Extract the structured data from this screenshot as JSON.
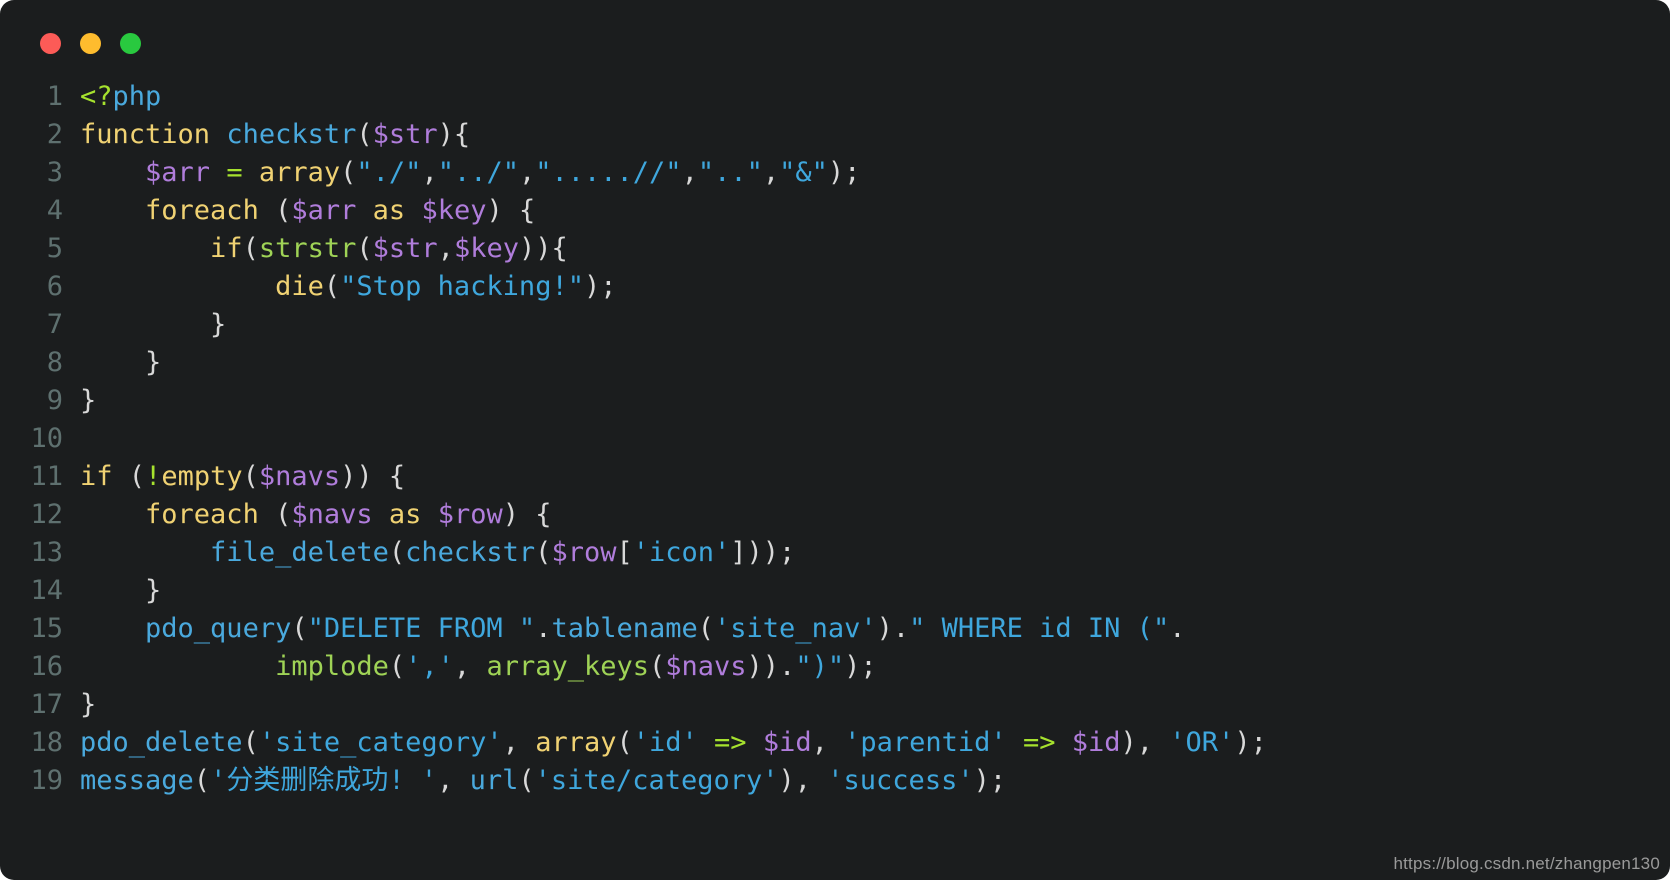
{
  "window": {
    "traffic_lights": [
      {
        "name": "close",
        "color": "#fc5b57"
      },
      {
        "name": "minimize",
        "color": "#febc2e"
      },
      {
        "name": "maximize",
        "color": "#29c93f"
      }
    ],
    "background": "#1b1d1e"
  },
  "editor": {
    "language": "php",
    "gutter_color": "#5e706f",
    "line_count": 19,
    "line_numbers": [
      "1",
      "2",
      "3",
      "4",
      "5",
      "6",
      "7",
      "8",
      "9",
      "10",
      "11",
      "12",
      "13",
      "14",
      "15",
      "16",
      "17",
      "18",
      "19"
    ],
    "lines": [
      {
        "n": "1",
        "text": "<?php"
      },
      {
        "n": "2",
        "text": "function checkstr($str){"
      },
      {
        "n": "3",
        "text": "    $arr = array(\"./\",\"../\",\".....//\",\"..\",\"&\");"
      },
      {
        "n": "4",
        "text": "    foreach ($arr as $key) {"
      },
      {
        "n": "5",
        "text": "        if(strstr($str,$key)){"
      },
      {
        "n": "6",
        "text": "            die(\"Stop hacking!\");"
      },
      {
        "n": "7",
        "text": "        }"
      },
      {
        "n": "8",
        "text": "    }"
      },
      {
        "n": "9",
        "text": "}"
      },
      {
        "n": "10",
        "text": ""
      },
      {
        "n": "11",
        "text": "if (!empty($navs)) {"
      },
      {
        "n": "12",
        "text": "    foreach ($navs as $row) {"
      },
      {
        "n": "13",
        "text": "        file_delete(checkstr($row['icon']));"
      },
      {
        "n": "14",
        "text": "    }"
      },
      {
        "n": "15",
        "text": "    pdo_query(\"DELETE FROM \".tablename('site_nav').\" WHERE id IN (\"."
      },
      {
        "n": "16",
        "text": "            implode(',', array_keys($navs)).\")\");"
      },
      {
        "n": "17",
        "text": "}"
      },
      {
        "n": "18",
        "text": "pdo_delete('site_category', array('id' => $id, 'parentid' => $id), 'OR');"
      },
      {
        "n": "19",
        "text": "message('分类删除成功! ', url('site/category'), 'success');"
      }
    ],
    "tokens": [
      [
        {
          "c": "tag",
          "t": "<?"
        },
        {
          "c": "fn",
          "t": "php"
        }
      ],
      [
        {
          "c": "kw",
          "t": "function"
        },
        {
          "c": "plain",
          "t": " "
        },
        {
          "c": "fn",
          "t": "checkstr"
        },
        {
          "c": "punct",
          "t": "("
        },
        {
          "c": "var",
          "t": "$str"
        },
        {
          "c": "punct",
          "t": "){"
        }
      ],
      [
        {
          "c": "plain",
          "t": "    "
        },
        {
          "c": "var",
          "t": "$arr"
        },
        {
          "c": "plain",
          "t": " "
        },
        {
          "c": "op",
          "t": "="
        },
        {
          "c": "plain",
          "t": " "
        },
        {
          "c": "kw",
          "t": "array"
        },
        {
          "c": "punct",
          "t": "("
        },
        {
          "c": "str",
          "t": "\"./\""
        },
        {
          "c": "punct",
          "t": ","
        },
        {
          "c": "str",
          "t": "\"../\""
        },
        {
          "c": "punct",
          "t": ","
        },
        {
          "c": "str",
          "t": "\".....//\""
        },
        {
          "c": "punct",
          "t": ","
        },
        {
          "c": "str",
          "t": "\"..\""
        },
        {
          "c": "punct",
          "t": ","
        },
        {
          "c": "str",
          "t": "\"&\""
        },
        {
          "c": "punct",
          "t": ");"
        }
      ],
      [
        {
          "c": "plain",
          "t": "    "
        },
        {
          "c": "kw",
          "t": "foreach"
        },
        {
          "c": "plain",
          "t": " "
        },
        {
          "c": "punct",
          "t": "("
        },
        {
          "c": "var",
          "t": "$arr"
        },
        {
          "c": "plain",
          "t": " "
        },
        {
          "c": "kw",
          "t": "as"
        },
        {
          "c": "plain",
          "t": " "
        },
        {
          "c": "var",
          "t": "$key"
        },
        {
          "c": "punct",
          "t": ") {"
        }
      ],
      [
        {
          "c": "plain",
          "t": "        "
        },
        {
          "c": "kw",
          "t": "if"
        },
        {
          "c": "punct",
          "t": "("
        },
        {
          "c": "builtin",
          "t": "strstr"
        },
        {
          "c": "punct",
          "t": "("
        },
        {
          "c": "var",
          "t": "$str"
        },
        {
          "c": "punct",
          "t": ","
        },
        {
          "c": "var",
          "t": "$key"
        },
        {
          "c": "punct",
          "t": ")){"
        }
      ],
      [
        {
          "c": "plain",
          "t": "            "
        },
        {
          "c": "kw",
          "t": "die"
        },
        {
          "c": "punct",
          "t": "("
        },
        {
          "c": "str",
          "t": "\"Stop hacking!\""
        },
        {
          "c": "punct",
          "t": ");"
        }
      ],
      [
        {
          "c": "plain",
          "t": "        "
        },
        {
          "c": "punct",
          "t": "}"
        }
      ],
      [
        {
          "c": "plain",
          "t": "    "
        },
        {
          "c": "punct",
          "t": "}"
        }
      ],
      [
        {
          "c": "punct",
          "t": "}"
        }
      ],
      [],
      [
        {
          "c": "kw",
          "t": "if"
        },
        {
          "c": "plain",
          "t": " "
        },
        {
          "c": "punct",
          "t": "("
        },
        {
          "c": "op",
          "t": "!"
        },
        {
          "c": "kw",
          "t": "empty"
        },
        {
          "c": "punct",
          "t": "("
        },
        {
          "c": "var",
          "t": "$navs"
        },
        {
          "c": "punct",
          "t": ")) {"
        }
      ],
      [
        {
          "c": "plain",
          "t": "    "
        },
        {
          "c": "kw",
          "t": "foreach"
        },
        {
          "c": "plain",
          "t": " "
        },
        {
          "c": "punct",
          "t": "("
        },
        {
          "c": "var",
          "t": "$navs"
        },
        {
          "c": "plain",
          "t": " "
        },
        {
          "c": "kw",
          "t": "as"
        },
        {
          "c": "plain",
          "t": " "
        },
        {
          "c": "var",
          "t": "$row"
        },
        {
          "c": "punct",
          "t": ") {"
        }
      ],
      [
        {
          "c": "plain",
          "t": "        "
        },
        {
          "c": "fn",
          "t": "file_delete"
        },
        {
          "c": "punct",
          "t": "("
        },
        {
          "c": "fn",
          "t": "checkstr"
        },
        {
          "c": "punct",
          "t": "("
        },
        {
          "c": "var",
          "t": "$row"
        },
        {
          "c": "punct",
          "t": "["
        },
        {
          "c": "str",
          "t": "'icon'"
        },
        {
          "c": "punct",
          "t": "]));"
        }
      ],
      [
        {
          "c": "plain",
          "t": "    "
        },
        {
          "c": "punct",
          "t": "}"
        }
      ],
      [
        {
          "c": "plain",
          "t": "    "
        },
        {
          "c": "fn",
          "t": "pdo_query"
        },
        {
          "c": "punct",
          "t": "("
        },
        {
          "c": "str",
          "t": "\"DELETE FROM \""
        },
        {
          "c": "punct",
          "t": "."
        },
        {
          "c": "fn",
          "t": "tablename"
        },
        {
          "c": "punct",
          "t": "("
        },
        {
          "c": "str",
          "t": "'site_nav'"
        },
        {
          "c": "punct",
          "t": ")."
        },
        {
          "c": "str",
          "t": "\" WHERE id IN (\""
        },
        {
          "c": "punct",
          "t": "."
        }
      ],
      [
        {
          "c": "plain",
          "t": "            "
        },
        {
          "c": "builtin",
          "t": "implode"
        },
        {
          "c": "punct",
          "t": "("
        },
        {
          "c": "str",
          "t": "','"
        },
        {
          "c": "punct",
          "t": ", "
        },
        {
          "c": "builtin",
          "t": "array_keys"
        },
        {
          "c": "punct",
          "t": "("
        },
        {
          "c": "var",
          "t": "$navs"
        },
        {
          "c": "punct",
          "t": "))."
        },
        {
          "c": "str",
          "t": "\")\""
        },
        {
          "c": "punct",
          "t": ");"
        }
      ],
      [
        {
          "c": "punct",
          "t": "}"
        }
      ],
      [
        {
          "c": "fn",
          "t": "pdo_delete"
        },
        {
          "c": "punct",
          "t": "("
        },
        {
          "c": "str",
          "t": "'site_category'"
        },
        {
          "c": "punct",
          "t": ", "
        },
        {
          "c": "kw",
          "t": "array"
        },
        {
          "c": "punct",
          "t": "("
        },
        {
          "c": "str",
          "t": "'id'"
        },
        {
          "c": "plain",
          "t": " "
        },
        {
          "c": "op",
          "t": "=>"
        },
        {
          "c": "plain",
          "t": " "
        },
        {
          "c": "var",
          "t": "$id"
        },
        {
          "c": "punct",
          "t": ", "
        },
        {
          "c": "str",
          "t": "'parentid'"
        },
        {
          "c": "plain",
          "t": " "
        },
        {
          "c": "op",
          "t": "=>"
        },
        {
          "c": "plain",
          "t": " "
        },
        {
          "c": "var",
          "t": "$id"
        },
        {
          "c": "punct",
          "t": "), "
        },
        {
          "c": "str",
          "t": "'OR'"
        },
        {
          "c": "punct",
          "t": ");"
        }
      ],
      [
        {
          "c": "fn",
          "t": "message"
        },
        {
          "c": "punct",
          "t": "("
        },
        {
          "c": "str",
          "t": "'分类删除成功! '"
        },
        {
          "c": "punct",
          "t": ", "
        },
        {
          "c": "fn",
          "t": "url"
        },
        {
          "c": "punct",
          "t": "("
        },
        {
          "c": "str",
          "t": "'site/category'"
        },
        {
          "c": "punct",
          "t": "), "
        },
        {
          "c": "str",
          "t": "'success'"
        },
        {
          "c": "punct",
          "t": ");"
        }
      ]
    ]
  },
  "watermark": {
    "text": "https://blog.csdn.net/zhangpen130"
  },
  "colors": {
    "background": "#1b1d1e",
    "keyword": "#f0d273",
    "function": "#4aa9dd",
    "builtin": "#9fd356",
    "variable": "#b07ddb",
    "string": "#3fa7dd",
    "operator": "#a6e22e",
    "punctuation": "#d8d8d8",
    "line_number": "#5e706f"
  }
}
